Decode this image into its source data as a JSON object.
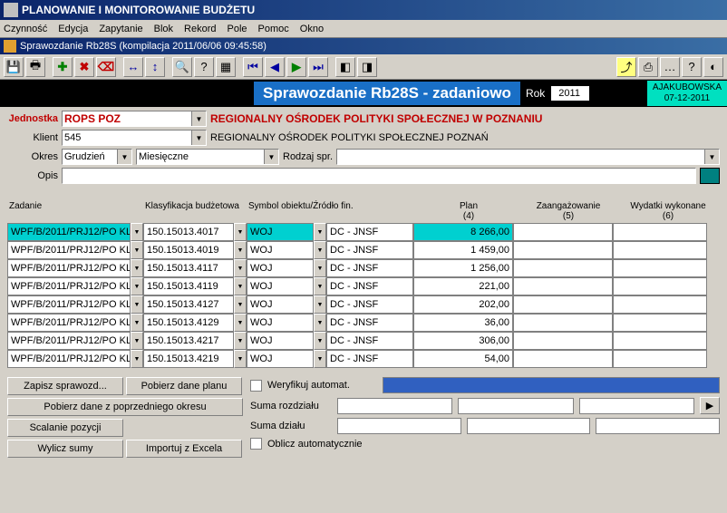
{
  "window": {
    "title": "PLANOWANIE I MONITOROWANIE BUDŻETU"
  },
  "menu": {
    "czynnosc": "Czynność",
    "edycja": "Edycja",
    "zapytanie": "Zapytanie",
    "blok": "Blok",
    "rekord": "Rekord",
    "pole": "Pole",
    "pomoc": "Pomoc",
    "okno": "Okno"
  },
  "subtitle": "Sprawozdanie Rb28S (kompilacja 2011/06/06 09:45:58)",
  "header": {
    "title": "Sprawozdanie Rb28S - zadaniowo",
    "rok_label": "Rok",
    "rok_value": "2011",
    "user": "AJAKUBOWSKA",
    "date": "07-12-2011"
  },
  "form": {
    "jednostka_label": "Jednostka",
    "jednostka_value": "ROPS POZ",
    "jednostka_desc": "REGIONALNY OŚRODEK POLITYKI SPOŁECZNEJ W POZNANIU",
    "klient_label": "Klient",
    "klient_value": "545",
    "klient_desc": "REGIONALNY OŚRODEK POLITYKI SPOŁECZNEJ POZNAŃ",
    "okres_label": "Okres",
    "okres_month": "Grudzień",
    "okres_type": "Miesięczne",
    "rodzaj_label": "Rodzaj spr.",
    "rodzaj_value": "",
    "opis_label": "Opis",
    "opis_value": ""
  },
  "grid": {
    "headers": {
      "zadanie": "Zadanie",
      "klasyfikacja": "Klasyfikacja budżetowa",
      "symbol": "Symbol obiektu/Źródło fin.",
      "plan": "Plan\n(4)",
      "zaang": "Zaangażowanie\n(5)",
      "wydatki": "Wydatki wykonane\n(6)"
    },
    "rows": [
      {
        "zadanie": "WPF/B/2011/PRJ12/PO KL",
        "klas": "150.15013.4017",
        "sym": "WOJ",
        "zr": "DC - JNSF",
        "plan": "8 266,00",
        "sel": true
      },
      {
        "zadanie": "WPF/B/2011/PRJ12/PO KL",
        "klas": "150.15013.4019",
        "sym": "WOJ",
        "zr": "DC - JNSF",
        "plan": "1 459,00"
      },
      {
        "zadanie": "WPF/B/2011/PRJ12/PO KL",
        "klas": "150.15013.4117",
        "sym": "WOJ",
        "zr": "DC - JNSF",
        "plan": "1 256,00"
      },
      {
        "zadanie": "WPF/B/2011/PRJ12/PO KL",
        "klas": "150.15013.4119",
        "sym": "WOJ",
        "zr": "DC - JNSF",
        "plan": "221,00"
      },
      {
        "zadanie": "WPF/B/2011/PRJ12/PO KL",
        "klas": "150.15013.4127",
        "sym": "WOJ",
        "zr": "DC - JNSF",
        "plan": "202,00"
      },
      {
        "zadanie": "WPF/B/2011/PRJ12/PO KL",
        "klas": "150.15013.4129",
        "sym": "WOJ",
        "zr": "DC - JNSF",
        "plan": "36,00"
      },
      {
        "zadanie": "WPF/B/2011/PRJ12/PO KL",
        "klas": "150.15013.4217",
        "sym": "WOJ",
        "zr": "DC - JNSF",
        "plan": "306,00"
      },
      {
        "zadanie": "WPF/B/2011/PRJ12/PO KL",
        "klas": "150.15013.4219",
        "sym": "WOJ",
        "zr": "DC - JNSF",
        "plan": "54,00"
      }
    ]
  },
  "bottom": {
    "zapisz": "Zapisz sprawozd...",
    "pobierz_plan": "Pobierz dane planu",
    "pobierz_poprz": "Pobierz dane z poprzedniego okresu",
    "scalanie": "Scalanie pozycji",
    "wylicz": "Wylicz sumy",
    "importuj": "Importuj z Excela",
    "weryfikuj": "Weryfikuj automat.",
    "suma_rozdz": "Suma rozdziału",
    "suma_dzialu": "Suma działu",
    "oblicz": "Oblicz automatycznie"
  }
}
